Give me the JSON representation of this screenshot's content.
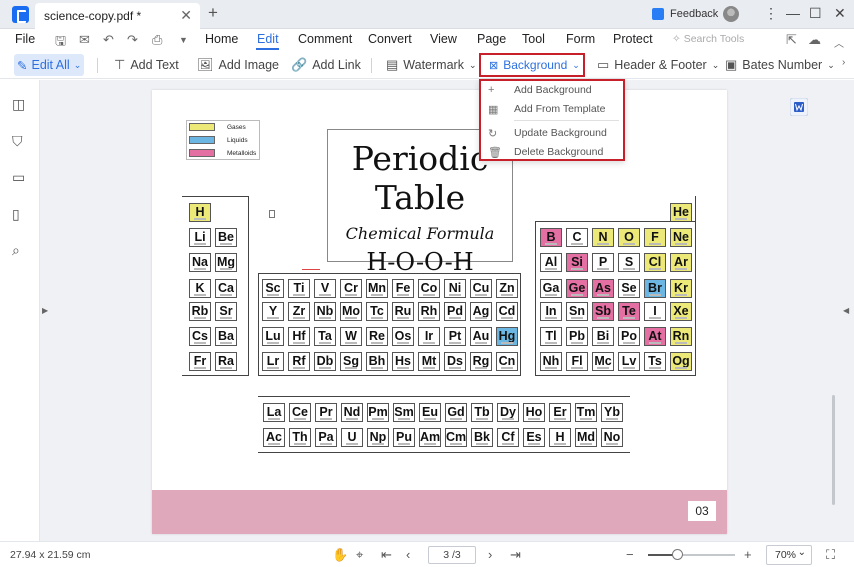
{
  "titlebar": {
    "tab_title": "science-copy.pdf *",
    "tab_close": "✕",
    "new_tab": "+",
    "feedback": "Feedback",
    "window_controls": [
      "⋮",
      "—",
      "☐",
      "✕"
    ]
  },
  "menubar": {
    "file": "File",
    "items": [
      "Home",
      "Edit",
      "Comment",
      "Convert",
      "View",
      "Page",
      "Tool",
      "Form",
      "Protect"
    ],
    "active": "Edit",
    "search_placeholder": "Search Tools"
  },
  "toolbar": {
    "edit_all": "Edit All",
    "add_text": "Add Text",
    "add_image": "Add Image",
    "add_link": "Add Link",
    "watermark": "Watermark",
    "background": "Background",
    "header_footer": "Header & Footer",
    "bates_number": "Bates Number"
  },
  "background_menu": {
    "items": [
      "Add Background",
      "Add From Template",
      "Update Background",
      "Delete Background"
    ]
  },
  "document": {
    "legend": [
      "Gases",
      "Liquids",
      "Metalloids"
    ],
    "title": "Periodic Table",
    "subtitle": "Chemical Formula",
    "formula": "H-O-O-H",
    "page_number": "03",
    "elements": [
      {
        "s": "H",
        "c": 1,
        "r": 1,
        "t": "gas"
      },
      {
        "s": "Li",
        "c": 1,
        "r": 2
      },
      {
        "s": "Be",
        "c": 2,
        "r": 2
      },
      {
        "s": "Na",
        "c": 1,
        "r": 3
      },
      {
        "s": "Mg",
        "c": 2,
        "r": 3
      },
      {
        "s": "K",
        "c": 1,
        "r": 4
      },
      {
        "s": "Ca",
        "c": 2,
        "r": 4
      },
      {
        "s": "Rb",
        "c": 1,
        "r": 5
      },
      {
        "s": "Sr",
        "c": 2,
        "r": 5
      },
      {
        "s": "Cs",
        "c": 1,
        "r": 6
      },
      {
        "s": "Ba",
        "c": 2,
        "r": 6
      },
      {
        "s": "Fr",
        "c": 1,
        "r": 7
      },
      {
        "s": "Ra",
        "c": 2,
        "r": 7
      },
      {
        "s": "Sc",
        "c": 3,
        "r": 4
      },
      {
        "s": "Ti",
        "c": 4,
        "r": 4
      },
      {
        "s": "V",
        "c": 5,
        "r": 4
      },
      {
        "s": "Cr",
        "c": 6,
        "r": 4
      },
      {
        "s": "Mn",
        "c": 7,
        "r": 4
      },
      {
        "s": "Fe",
        "c": 8,
        "r": 4
      },
      {
        "s": "Co",
        "c": 9,
        "r": 4
      },
      {
        "s": "Ni",
        "c": 10,
        "r": 4
      },
      {
        "s": "Cu",
        "c": 11,
        "r": 4
      },
      {
        "s": "Zn",
        "c": 12,
        "r": 4
      },
      {
        "s": "Y",
        "c": 3,
        "r": 5
      },
      {
        "s": "Zr",
        "c": 4,
        "r": 5
      },
      {
        "s": "Nb",
        "c": 5,
        "r": 5
      },
      {
        "s": "Mo",
        "c": 6,
        "r": 5
      },
      {
        "s": "Tc",
        "c": 7,
        "r": 5
      },
      {
        "s": "Ru",
        "c": 8,
        "r": 5
      },
      {
        "s": "Rh",
        "c": 9,
        "r": 5
      },
      {
        "s": "Pd",
        "c": 10,
        "r": 5
      },
      {
        "s": "Ag",
        "c": 11,
        "r": 5
      },
      {
        "s": "Cd",
        "c": 12,
        "r": 5
      },
      {
        "s": "Lu",
        "c": 3,
        "r": 6
      },
      {
        "s": "Hf",
        "c": 4,
        "r": 6
      },
      {
        "s": "Ta",
        "c": 5,
        "r": 6
      },
      {
        "s": "W",
        "c": 6,
        "r": 6
      },
      {
        "s": "Re",
        "c": 7,
        "r": 6
      },
      {
        "s": "Os",
        "c": 8,
        "r": 6
      },
      {
        "s": "Ir",
        "c": 9,
        "r": 6
      },
      {
        "s": "Pt",
        "c": 10,
        "r": 6
      },
      {
        "s": "Au",
        "c": 11,
        "r": 6
      },
      {
        "s": "Hg",
        "c": 12,
        "r": 6,
        "t": "liq"
      },
      {
        "s": "Lr",
        "c": 3,
        "r": 7
      },
      {
        "s": "Rf",
        "c": 4,
        "r": 7
      },
      {
        "s": "Db",
        "c": 5,
        "r": 7
      },
      {
        "s": "Sg",
        "c": 6,
        "r": 7
      },
      {
        "s": "Bh",
        "c": 7,
        "r": 7
      },
      {
        "s": "Hs",
        "c": 8,
        "r": 7
      },
      {
        "s": "Mt",
        "c": 9,
        "r": 7
      },
      {
        "s": "Ds",
        "c": 10,
        "r": 7
      },
      {
        "s": "Rg",
        "c": 11,
        "r": 7
      },
      {
        "s": "Cn",
        "c": 12,
        "r": 7
      },
      {
        "s": "He",
        "c": 18,
        "r": 1,
        "t": "gas"
      },
      {
        "s": "B",
        "c": 13,
        "r": 2,
        "t": "met"
      },
      {
        "s": "C",
        "c": 14,
        "r": 2
      },
      {
        "s": "N",
        "c": 15,
        "r": 2,
        "t": "gas"
      },
      {
        "s": "O",
        "c": 16,
        "r": 2,
        "t": "gas"
      },
      {
        "s": "F",
        "c": 17,
        "r": 2,
        "t": "gas"
      },
      {
        "s": "Ne",
        "c": 18,
        "r": 2,
        "t": "gas"
      },
      {
        "s": "Al",
        "c": 13,
        "r": 3
      },
      {
        "s": "Si",
        "c": 14,
        "r": 3,
        "t": "met"
      },
      {
        "s": "P",
        "c": 15,
        "r": 3
      },
      {
        "s": "S",
        "c": 16,
        "r": 3
      },
      {
        "s": "Cl",
        "c": 17,
        "r": 3,
        "t": "gas"
      },
      {
        "s": "Ar",
        "c": 18,
        "r": 3,
        "t": "gas"
      },
      {
        "s": "Ga",
        "c": 13,
        "r": 4
      },
      {
        "s": "Ge",
        "c": 14,
        "r": 4,
        "t": "met"
      },
      {
        "s": "As",
        "c": 15,
        "r": 4,
        "t": "met"
      },
      {
        "s": "Se",
        "c": 16,
        "r": 4
      },
      {
        "s": "Br",
        "c": 17,
        "r": 4,
        "t": "liq"
      },
      {
        "s": "Kr",
        "c": 18,
        "r": 4,
        "t": "gas"
      },
      {
        "s": "In",
        "c": 13,
        "r": 5
      },
      {
        "s": "Sn",
        "c": 14,
        "r": 5
      },
      {
        "s": "Sb",
        "c": 15,
        "r": 5,
        "t": "met"
      },
      {
        "s": "Te",
        "c": 16,
        "r": 5,
        "t": "met"
      },
      {
        "s": "I",
        "c": 17,
        "r": 5
      },
      {
        "s": "Xe",
        "c": 18,
        "r": 5,
        "t": "gas"
      },
      {
        "s": "Tl",
        "c": 13,
        "r": 6
      },
      {
        "s": "Pb",
        "c": 14,
        "r": 6
      },
      {
        "s": "Bi",
        "c": 15,
        "r": 6
      },
      {
        "s": "Po",
        "c": 16,
        "r": 6
      },
      {
        "s": "At",
        "c": 17,
        "r": 6,
        "t": "met"
      },
      {
        "s": "Rn",
        "c": 18,
        "r": 6,
        "t": "gas"
      },
      {
        "s": "Nh",
        "c": 13,
        "r": 7
      },
      {
        "s": "Fl",
        "c": 14,
        "r": 7
      },
      {
        "s": "Mc",
        "c": 15,
        "r": 7
      },
      {
        "s": "Lv",
        "c": 16,
        "r": 7
      },
      {
        "s": "Ts",
        "c": 17,
        "r": 7
      },
      {
        "s": "Og",
        "c": 18,
        "r": 7,
        "t": "gas"
      }
    ],
    "f_block": [
      [
        "La",
        "Ce",
        "Pr",
        "Nd",
        "Pm",
        "Sm",
        "Eu",
        "Gd",
        "Tb",
        "Dy",
        "Ho",
        "Er",
        "Tm",
        "Yb"
      ],
      [
        "Ac",
        "Th",
        "Pa",
        "U",
        "Np",
        "Pu",
        "Am",
        "Cm",
        "Bk",
        "Cf",
        "Es",
        "H",
        "Md",
        "No"
      ]
    ]
  },
  "statusbar": {
    "dimensions": "27.94 x 21.59 cm",
    "page_indicator": "3 /3",
    "zoom": "70%",
    "zoom_level": 0.33
  },
  "colors": {
    "accent": "#2d6fe0",
    "highlight_border": "#c8202a",
    "gas": "#ece978",
    "liquid": "#6bb6e3",
    "metalloid": "#e46fa3",
    "footer": "#e0a8bb"
  }
}
